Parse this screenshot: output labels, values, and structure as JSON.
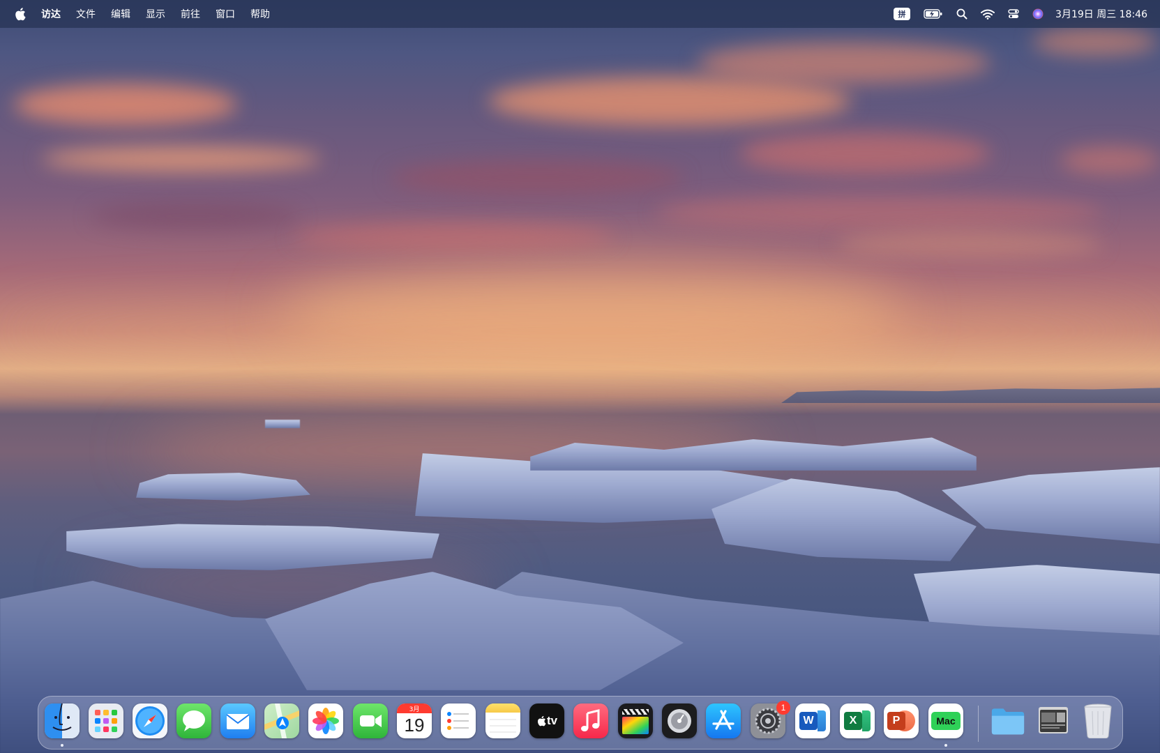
{
  "menubar": {
    "apple_icon": "apple-logo-icon",
    "app_name": "访达",
    "menus": [
      "文件",
      "编辑",
      "显示",
      "前往",
      "窗口",
      "帮助"
    ],
    "status": {
      "input_method": "拼",
      "battery_icon": "battery-charging-icon",
      "search_icon": "spotlight-search-icon",
      "wifi_icon": "wifi-icon",
      "control_center_icon": "control-center-icon",
      "siri_icon": "siri-icon",
      "datetime": "3月19日 周三  18:46"
    }
  },
  "dock": {
    "apps": [
      {
        "name": "Finder",
        "icon": "finder-icon",
        "running": true
      },
      {
        "name": "Launchpad",
        "icon": "launchpad-icon"
      },
      {
        "name": "Safari",
        "icon": "safari-icon"
      },
      {
        "name": "Messages",
        "icon": "messages-icon"
      },
      {
        "name": "Mail",
        "icon": "mail-icon"
      },
      {
        "name": "Maps",
        "icon": "maps-icon"
      },
      {
        "name": "Photos",
        "icon": "photos-icon"
      },
      {
        "name": "FaceTime",
        "icon": "facetime-icon"
      },
      {
        "name": "Calendar",
        "icon": "calendar-icon",
        "month": "3月",
        "day": "19"
      },
      {
        "name": "Reminders",
        "icon": "reminders-icon"
      },
      {
        "name": "Notes",
        "icon": "notes-icon"
      },
      {
        "name": "TV",
        "icon": "apple-tv-icon",
        "label": "tv"
      },
      {
        "name": "Music",
        "icon": "music-icon"
      },
      {
        "name": "Final Cut Pro",
        "icon": "final-cut-pro-icon"
      },
      {
        "name": "Logic Pro",
        "icon": "logic-pro-icon"
      },
      {
        "name": "App Store",
        "icon": "app-store-icon"
      },
      {
        "name": "System Settings",
        "icon": "system-settings-icon",
        "badge": "1"
      },
      {
        "name": "Microsoft Word",
        "icon": "word-icon",
        "letter": "W"
      },
      {
        "name": "Microsoft Excel",
        "icon": "excel-icon",
        "letter": "X"
      },
      {
        "name": "Microsoft PowerPoint",
        "icon": "powerpoint-icon",
        "letter": "P"
      },
      {
        "name": "Mac App",
        "icon": "mac-app-icon",
        "label": "Mac",
        "running": true
      },
      {
        "name": "Folder",
        "icon": "folder-icon"
      },
      {
        "name": "Downloads Stack",
        "icon": "downloads-stack-icon"
      },
      {
        "name": "Trash",
        "icon": "trash-icon"
      }
    ]
  },
  "colors": {
    "menubar_bg": "#283456",
    "badge_red": "#ff3b30",
    "sky_top": "#3c4a74",
    "horizon_glow": "#e2ae86"
  }
}
